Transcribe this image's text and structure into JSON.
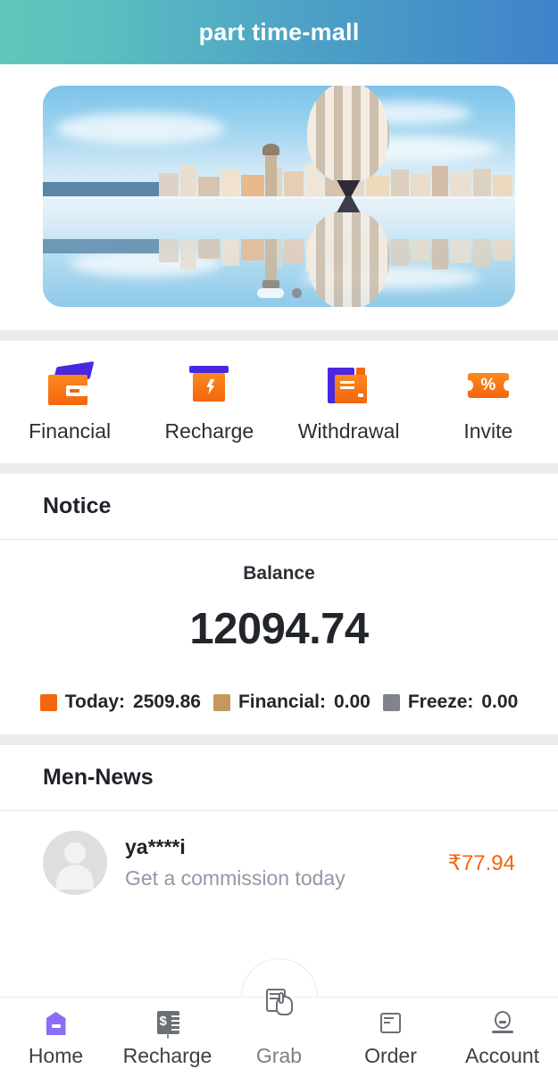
{
  "header": {
    "title": "part time-mall"
  },
  "banner": {
    "image_alt": "mirrored cityscape with hot air balloon",
    "dots": [
      {
        "name": "slide-1",
        "active": true
      },
      {
        "name": "slide-2",
        "active": false
      }
    ]
  },
  "quick_actions": [
    {
      "label": "Financial",
      "icon": "wallet-icon"
    },
    {
      "label": "Recharge",
      "icon": "recharge-card-icon"
    },
    {
      "label": "Withdrawal",
      "icon": "withdrawal-card-icon"
    },
    {
      "label": "Invite",
      "icon": "percent-ticket-icon"
    }
  ],
  "notice": {
    "title": "Notice"
  },
  "balance": {
    "label": "Balance",
    "value": "12094.74",
    "stats": [
      {
        "label": "Today:",
        "value": "2509.86",
        "color": "#f4650e"
      },
      {
        "label": "Financial:",
        "value": "0.00",
        "color": "#c49a5c"
      },
      {
        "label": "Freeze:",
        "value": "0.00",
        "color": "#808387"
      }
    ]
  },
  "news": {
    "title": "Men-News",
    "items": [
      {
        "name": "ya****i",
        "subtitle": "Get a commission today",
        "amount": "₹77.94"
      }
    ]
  },
  "tabbar": {
    "items": [
      {
        "label": "Home",
        "icon": "home-icon",
        "active": true
      },
      {
        "label": "Recharge",
        "icon": "receipt-icon",
        "active": false
      },
      {
        "label": "Grab",
        "icon": "grab-hand-icon",
        "active": false
      },
      {
        "label": "Order",
        "icon": "order-doc-icon",
        "active": false
      },
      {
        "label": "Account",
        "icon": "account-icon",
        "active": false
      }
    ]
  },
  "colors": {
    "header_gradient_start": "#62c6bc",
    "header_gradient_end": "#3f83ca",
    "accent_orange": "#f4650e",
    "accent_purple": "#8a6ef5",
    "icon_purple": "#4a27e0",
    "divider_gray": "#ececec"
  }
}
